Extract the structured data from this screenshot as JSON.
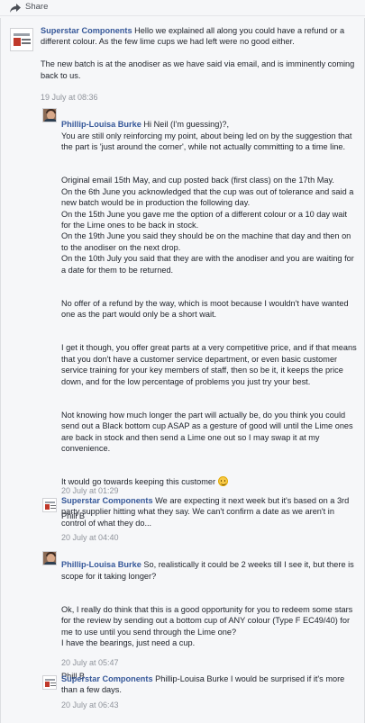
{
  "header": {
    "share_label": "Share",
    "share_icon": "share-arrow-icon"
  },
  "comments": [
    {
      "author": "Superstar Components",
      "paragraphs": [
        "Hello we explained all along you could have a refund or a different colour. As the few lime cups we had left were no good either.",
        "The new batch is at the anodiser as we have said via email, and is imminently coming back to us."
      ],
      "timestamp": "19 July at 08:36"
    },
    {
      "author": "Phillip-Louisa Burke",
      "paragraphs": [
        "Hi Neil (I'm guessing)?,\nYou are still only reinforcing my point, about being led on by the suggestion that the part is 'just around the corner', while not actually committing to a time line.",
        "Original email 15th May, and cup posted back (first class) on the 17th May.\nOn the 6th June you acknowledged that the cup was out of tolerance and said a new batch would be in production the following day.\nOn the 15th June you gave me the option of a different colour or a 10 day wait for the Lime ones to be back in stock.\nOn the 19th June you said they should be on the machine that day and then on to the anodiser on the next drop.\nOn the 10th July you said that they are with the anodiser and you are waiting for a date for them to be returned.",
        "No offer of a refund by the way, which is moot because I wouldn't have wanted one as the part would only be a short wait.",
        "I get it though, you offer great parts at a very competitive price, and if that means that you don't have a customer service department, or even basic customer service training for your key members of staff, then so be it, it keeps the price down, and for the low percentage of problems you just try your best.",
        "Not knowing how much longer the part will actually be, do you think you could send out a Black bottom cup ASAP as a gesture of good will until the Lime ones are back in stock and then send a Lime one out so I may swap it at my convenience.",
        "It would go towards keeping this customer",
        "Phill B"
      ],
      "timestamp": "20 July at 01:29"
    },
    {
      "author": "Superstar Components",
      "paragraphs": [
        "We are expecting it next week but it's based on a 3rd party supplier hitting what they say. We can't confirm a date as we aren't in control of what they do..."
      ],
      "timestamp": "20 July at 04:40"
    },
    {
      "author": "Phillip-Louisa Burke",
      "paragraphs": [
        "So, realistically it could be 2 weeks till I see it, but there is scope for it taking longer?",
        "Ok, I really do think that this is a good opportunity for you to redeem some stars for the review by sending out a bottom cup of ANY colour (Type F EC49/40) for me to use until you send through the Lime one?\nI have the bearings, just need a cup.",
        "Phill B"
      ],
      "timestamp": "20 July at 05:47"
    },
    {
      "author": "Superstar Components",
      "paragraphs": [
        "Phillip-Louisa Burke I would be surprised if it's more than a few days."
      ],
      "timestamp": "20 July at 06:43"
    }
  ]
}
